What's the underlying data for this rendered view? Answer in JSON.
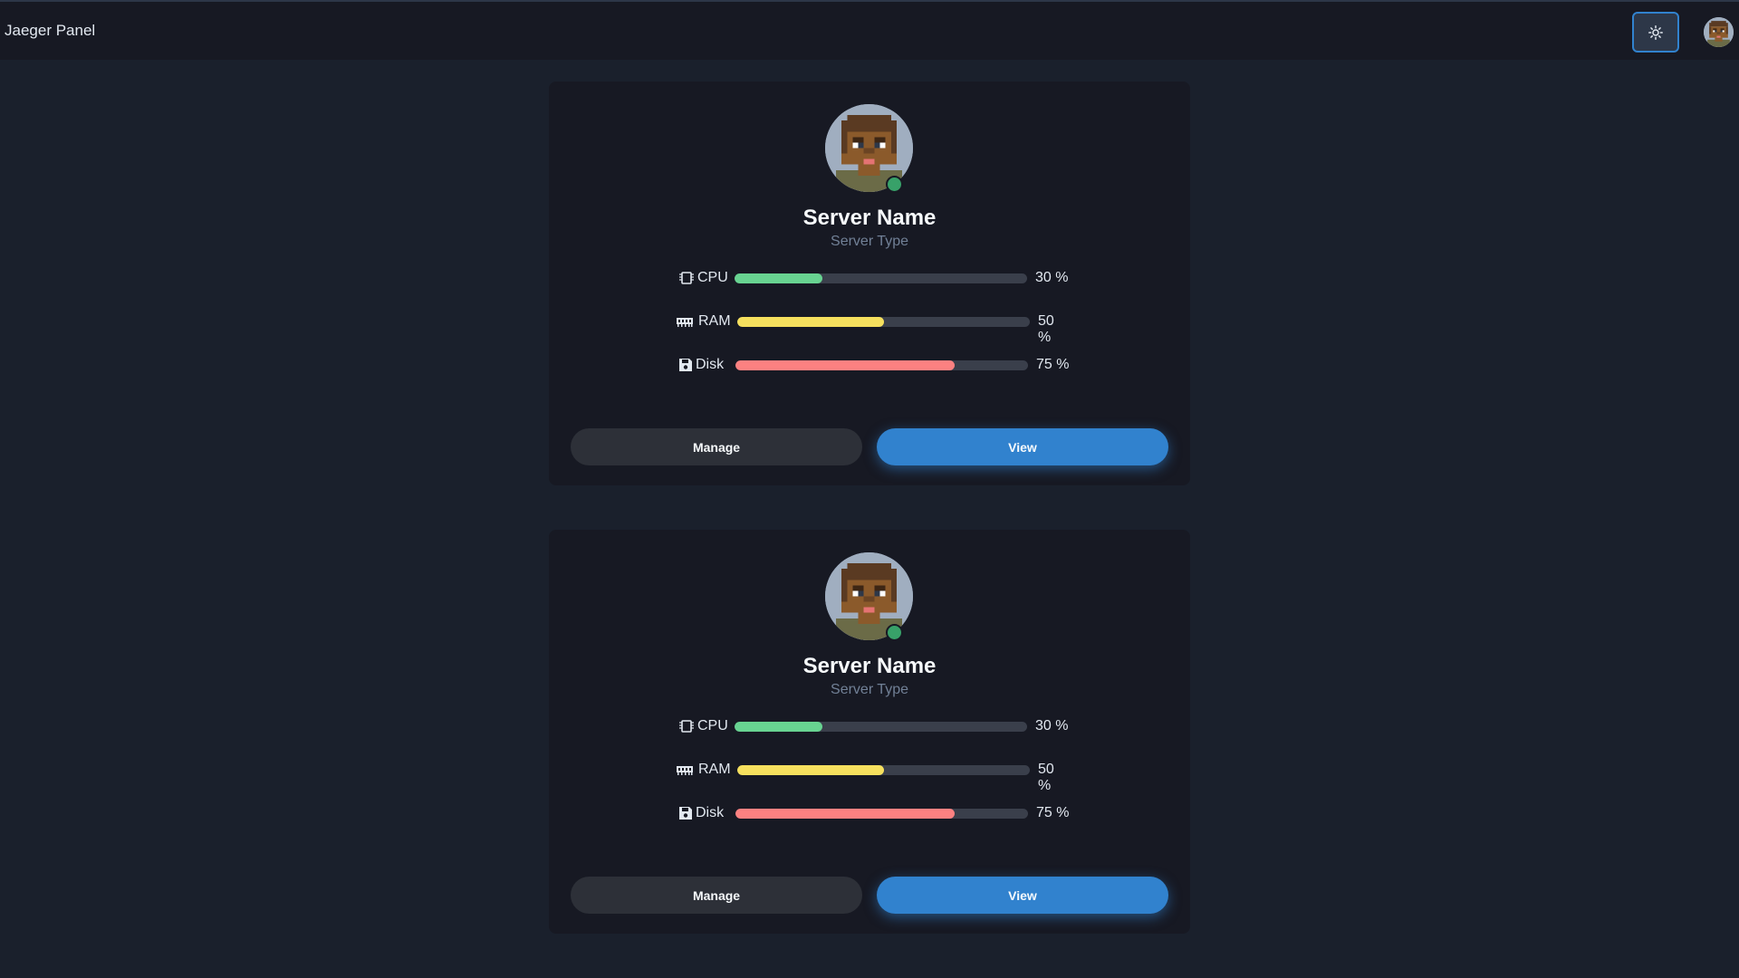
{
  "header": {
    "title": "Jaeger Panel",
    "theme_icon": "sun-icon",
    "avatar_icon": "user-avatar"
  },
  "colors": {
    "accent": "#3182ce",
    "cpu": "#68d391",
    "ram": "#f6e05e",
    "disk": "#fc8181",
    "online": "#38a169"
  },
  "servers": [
    {
      "name": "Server Name",
      "type": "Server Type",
      "status": "online",
      "metrics": [
        {
          "label": "CPU",
          "icon": "cpu-icon",
          "percent": 30,
          "text": "30 %"
        },
        {
          "label": "RAM",
          "icon": "ram-icon",
          "percent": 50,
          "text": "50 %"
        },
        {
          "label": "Disk",
          "icon": "disk-icon",
          "percent": 75,
          "text": "75 %"
        }
      ],
      "buttons": {
        "manage": "Manage",
        "view": "View"
      }
    },
    {
      "name": "Server Name",
      "type": "Server Type",
      "status": "online",
      "metrics": [
        {
          "label": "CPU",
          "icon": "cpu-icon",
          "percent": 30,
          "text": "30 %"
        },
        {
          "label": "RAM",
          "icon": "ram-icon",
          "percent": 50,
          "text": "50 %"
        },
        {
          "label": "Disk",
          "icon": "disk-icon",
          "percent": 75,
          "text": "75 %"
        }
      ],
      "buttons": {
        "manage": "Manage",
        "view": "View"
      }
    }
  ]
}
